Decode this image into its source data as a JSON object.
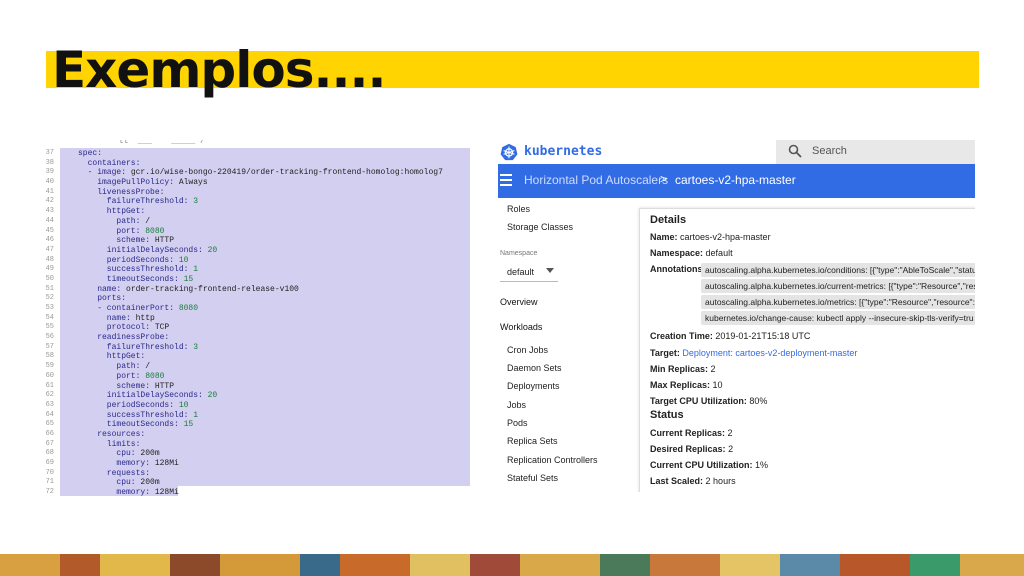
{
  "slide": {
    "title": "Exemplos....",
    "accent_color": "#ffd400"
  },
  "code": {
    "partial_top_line": "        ll  ___    _____ /",
    "lines": [
      {
        "n": "37",
        "text": "spec:"
      },
      {
        "n": "38",
        "text": "  containers:"
      },
      {
        "n": "39",
        "text": "  - image: gcr.io/wise-bongo-220419/order-tracking-frontend-homolog:homolog7"
      },
      {
        "n": "40",
        "text": "    imagePullPolicy: Always"
      },
      {
        "n": "41",
        "text": "    livenessProbe:"
      },
      {
        "n": "42",
        "text": "      failureThreshold: 3"
      },
      {
        "n": "43",
        "text": "      httpGet:"
      },
      {
        "n": "44",
        "text": "        path: /"
      },
      {
        "n": "45",
        "text": "        port: 8080"
      },
      {
        "n": "46",
        "text": "        scheme: HTTP"
      },
      {
        "n": "47",
        "text": "      initialDelaySeconds: 20"
      },
      {
        "n": "48",
        "text": "      periodSeconds: 10"
      },
      {
        "n": "49",
        "text": "      successThreshold: 1"
      },
      {
        "n": "50",
        "text": "      timeoutSeconds: 15"
      },
      {
        "n": "51",
        "text": "    name: order-tracking-frontend-release-v100"
      },
      {
        "n": "52",
        "text": "    ports:"
      },
      {
        "n": "53",
        "text": "    - containerPort: 8080"
      },
      {
        "n": "54",
        "text": "      name: http"
      },
      {
        "n": "55",
        "text": "      protocol: TCP"
      },
      {
        "n": "56",
        "text": "    readinessProbe:"
      },
      {
        "n": "57",
        "text": "      failureThreshold: 3"
      },
      {
        "n": "58",
        "text": "      httpGet:"
      },
      {
        "n": "59",
        "text": "        path: /"
      },
      {
        "n": "60",
        "text": "        port: 8080"
      },
      {
        "n": "61",
        "text": "        scheme: HTTP"
      },
      {
        "n": "62",
        "text": "      initialDelaySeconds: 20"
      },
      {
        "n": "63",
        "text": "      periodSeconds: 10"
      },
      {
        "n": "64",
        "text": "      successThreshold: 1"
      },
      {
        "n": "65",
        "text": "      timeoutSeconds: 15"
      },
      {
        "n": "66",
        "text": "    resources:"
      },
      {
        "n": "67",
        "text": "      limits:"
      },
      {
        "n": "68",
        "text": "        cpu: 200m"
      },
      {
        "n": "69",
        "text": "        memory: 128Mi"
      },
      {
        "n": "70",
        "text": "      requests:"
      },
      {
        "n": "71",
        "text": "        cpu: 200m"
      },
      {
        "n": "72",
        "text": "        memory: 128Mi"
      }
    ]
  },
  "dashboard": {
    "brand": "kubernetes",
    "brand_color": "#326ce5",
    "search": {
      "placeholder": "Search",
      "icon": "search-icon"
    },
    "breadcrumb": {
      "parent": "Horizontal Pod Autoscalers",
      "separator": ">",
      "current": "cartoes-v2-hpa-master"
    },
    "sidebar": {
      "top_items": [
        "Roles",
        "Storage Classes"
      ],
      "namespace_label": "Namespace",
      "namespace_value": "default",
      "overview": "Overview",
      "workloads": "Workloads",
      "workload_items": [
        "Cron Jobs",
        "Daemon Sets",
        "Deployments",
        "Jobs",
        "Pods",
        "Replica Sets",
        "Replication Controllers",
        "Stateful Sets"
      ]
    },
    "details": {
      "heading": "Details",
      "name_label": "Name:",
      "name_value": "cartoes-v2-hpa-master",
      "namespace_label": "Namespace:",
      "namespace_value": "default",
      "annotations_label": "Annotations:",
      "annotations": [
        "autoscaling.alpha.kubernetes.io/conditions:  [{\"type\":\"AbleToScale\",\"statu",
        "autoscaling.alpha.kubernetes.io/current-metrics:  [{\"type\":\"Resource\",\"reso",
        "autoscaling.alpha.kubernetes.io/metrics:  [{\"type\":\"Resource\",\"resource\":{\"",
        "kubernetes.io/change-cause:  kubectl apply --insecure-skip-tls-verify=tru"
      ],
      "creation_label": "Creation Time:",
      "creation_value": "2019-01-21T15:18 UTC",
      "target_label": "Target:",
      "target_value": "Deployment: cartoes-v2-deployment-master",
      "min_label": "Min Replicas:",
      "min_value": "2",
      "max_label": "Max Replicas:",
      "max_value": "10",
      "cpu_label": "Target CPU Utilization:",
      "cpu_value": "80%"
    },
    "status": {
      "heading": "Status",
      "current_label": "Current Replicas:",
      "current_value": "2",
      "desired_label": "Desired Replicas:",
      "desired_value": "2",
      "cpu_label": "Current CPU Utilization:",
      "cpu_value": "1%",
      "scaled_label": "Last Scaled:",
      "scaled_value": "2 hours"
    }
  }
}
